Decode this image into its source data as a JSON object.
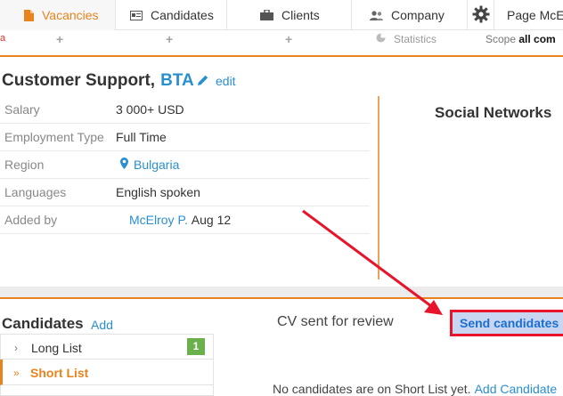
{
  "nav": {
    "vacancies": "Vacancies",
    "candidates": "Candidates",
    "clients": "Clients",
    "company": "Company",
    "page_user": "Page McE"
  },
  "subbar": {
    "left_fragment": "a",
    "statistics": "Statistics",
    "scope_label": "Scope",
    "scope_value": "all com"
  },
  "vacancy": {
    "title": "Customer Support,",
    "company": "BTA",
    "edit": "edit"
  },
  "details": [
    {
      "label": "Salary",
      "value": "3 000+ USD"
    },
    {
      "label": "Employment Type",
      "value": "Full Time"
    },
    {
      "label": "Region",
      "value": "Bulgaria"
    },
    {
      "label": "Languages",
      "value": "English spoken"
    },
    {
      "label": "Added by",
      "value_link": "McElroy P.",
      "value_date": "Aug 12"
    }
  ],
  "social": {
    "title": "Social Networks"
  },
  "candidates": {
    "title": "Candidates",
    "add": "Add",
    "cv_sent": "CV sent for review",
    "send_button": "Send candidates",
    "lists": [
      {
        "label": "Long List",
        "count": "1"
      },
      {
        "label": "Short List"
      }
    ],
    "empty_msg": "No candidates are on Short List yet.",
    "empty_link": "Add Candidate"
  },
  "colors": {
    "accent": "#e8831e",
    "link": "#2a8fd0",
    "highlight_border": "#e8142b",
    "count_badge": "#6ab04c"
  },
  "icons": [
    "vacancies-doc-icon",
    "candidates-card-icon",
    "clients-briefcase-icon",
    "company-users-icon",
    "settings-gear-icon",
    "pencil-icon",
    "map-pin-icon",
    "pie-chart-icon",
    "chevron-right-icon",
    "double-chevron-right-icon"
  ]
}
